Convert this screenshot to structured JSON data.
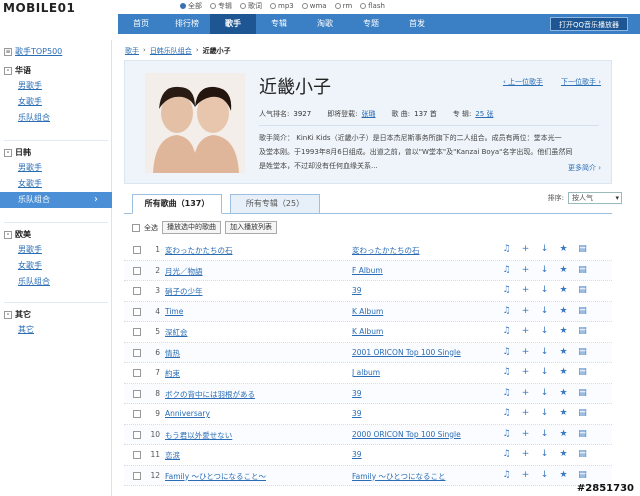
{
  "logo": "MOBILE01",
  "search_types": [
    {
      "label": "全部",
      "selected": true
    },
    {
      "label": "专辑",
      "selected": false
    },
    {
      "label": "歌词",
      "selected": false
    },
    {
      "label": "mp3",
      "selected": false
    },
    {
      "label": "wma",
      "selected": false
    },
    {
      "label": "rm",
      "selected": false
    },
    {
      "label": "flash",
      "selected": false
    }
  ],
  "nav": {
    "items": [
      "首页",
      "排行榜",
      "歌手",
      "专辑",
      "淘歌",
      "专题",
      "首发"
    ],
    "active_index": 2,
    "player_button": "打开QQ音乐播放器"
  },
  "sidebar": {
    "top_link": "歌手TOP500",
    "groups": [
      {
        "title": "华语",
        "items": [
          "男歌手",
          "女歌手",
          "乐队组合"
        ]
      },
      {
        "title": "日韩",
        "items": [
          "男歌手",
          "女歌手",
          "乐队组合"
        ]
      },
      {
        "title": "欧美",
        "items": [
          "男歌手",
          "女歌手",
          "乐队组合"
        ]
      },
      {
        "title": "其它",
        "items": [
          "其它"
        ]
      }
    ],
    "active": {
      "group": 1,
      "item": 2
    }
  },
  "breadcrumb": [
    "歌手",
    "日韩乐队组合",
    "近畿小子"
  ],
  "artist": {
    "name": "近畿小子",
    "prev": "上一位歌手",
    "next": "下一位歌手",
    "stats": {
      "rank_label": "人气排名:",
      "rank_value": "3927",
      "coming_label": "即将登载:",
      "coming_value": "张璐",
      "songs_label": "歌   曲:",
      "songs_value": "137 首",
      "albums_label": "专   辑:",
      "albums_value": "25 张"
    },
    "bio_lines": [
      "歌手简介： KinKi Kids（近畿小子）是日本杰尼斯事务所旗下的二人组合。成员有两位：堂本光一",
      "及堂本刚。于1993年8月6日组成。出道之前，曾以\"W堂本\"及\"Kanzai Boya\"名字出现。他们虽然同",
      "是姓堂本，不过却没有任何血缘关系..."
    ],
    "more": "更多简介"
  },
  "tabs": {
    "songs": "所有歌曲（137）",
    "albums": "所有专辑（25）"
  },
  "sort": {
    "label": "排序:",
    "value": "按人气"
  },
  "actions": {
    "select_all": "全选",
    "play_selected": "播放选中的歌曲",
    "add_playlist": "加入播放列表"
  },
  "songs": [
    {
      "num": "1",
      "title": "変わったかたちの石",
      "album": "変わったかたちの石"
    },
    {
      "num": "2",
      "title": "月光／物語",
      "album": "F Album"
    },
    {
      "num": "3",
      "title": "硝子の少年",
      "album": "39"
    },
    {
      "num": "4",
      "title": "Time",
      "album": "K Album"
    },
    {
      "num": "5",
      "title": "深紅会",
      "album": "K Album"
    },
    {
      "num": "6",
      "title": "情热",
      "album": "2001 ORICON Top 100 Single"
    },
    {
      "num": "7",
      "title": "約束",
      "album": "J album"
    },
    {
      "num": "8",
      "title": "ボクの背中には羽根がある",
      "album": "39"
    },
    {
      "num": "9",
      "title": "Anniversary",
      "album": "39"
    },
    {
      "num": "10",
      "title": "もう君以外愛せない",
      "album": "2000 ORICON Top 100 Single"
    },
    {
      "num": "11",
      "title": "恋涙",
      "album": "39"
    },
    {
      "num": "12",
      "title": "Family ～ひとつになること～",
      "album": "Family ～ひとつになること"
    }
  ],
  "watermark": "#2851730"
}
